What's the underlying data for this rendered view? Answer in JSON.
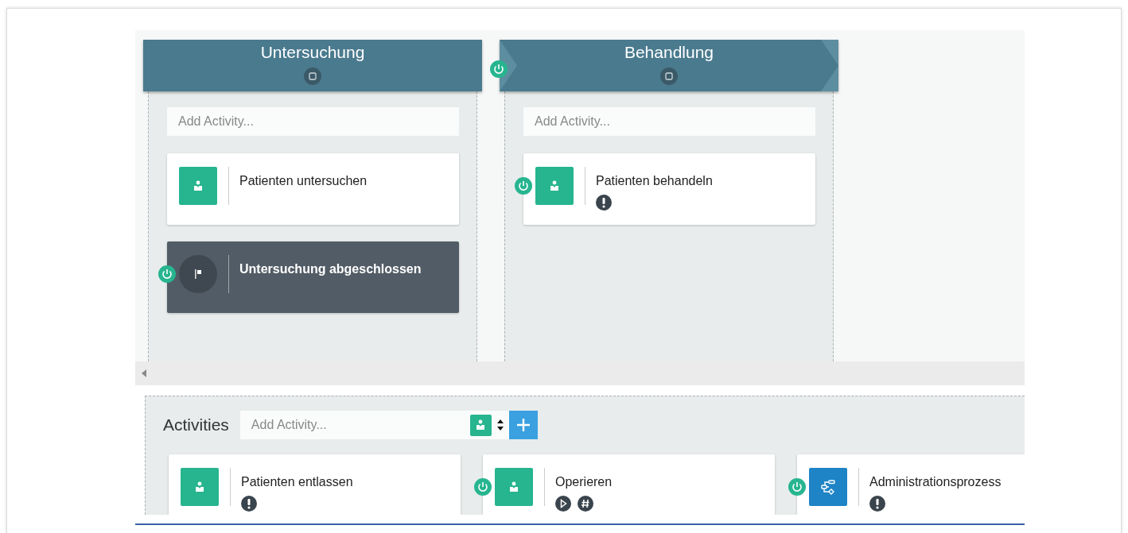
{
  "stages": [
    {
      "title": "Untersuchung",
      "entry_criterion": false,
      "placeholder": "Add Activity...",
      "activities": [
        {
          "title": "Patienten untersuchen",
          "kind": "human",
          "entry_criterion": false,
          "required": false,
          "autostart": false,
          "repeatable": false
        },
        {
          "title": "Untersuchung abgeschlossen",
          "kind": "milestone",
          "entry_criterion": true,
          "required": false,
          "autostart": false,
          "repeatable": false
        }
      ]
    },
    {
      "title": "Behandlung",
      "entry_criterion": true,
      "placeholder": "Add Activity...",
      "activities": [
        {
          "title": "Patienten behandeln",
          "kind": "human",
          "entry_criterion": true,
          "required": true,
          "autostart": false,
          "repeatable": false
        }
      ]
    }
  ],
  "activities_panel": {
    "title": "Activities",
    "placeholder": "Add Activity...",
    "activities": [
      {
        "title": "Patienten entlassen",
        "kind": "human",
        "entry_criterion": false,
        "required": true,
        "autostart": false,
        "repeatable": false
      },
      {
        "title": "Operieren",
        "kind": "human",
        "entry_criterion": true,
        "required": false,
        "autostart": true,
        "repeatable": true
      },
      {
        "title": "Administrationsprozess",
        "kind": "process",
        "entry_criterion": true,
        "required": true,
        "autostart": false,
        "repeatable": false
      }
    ]
  }
}
